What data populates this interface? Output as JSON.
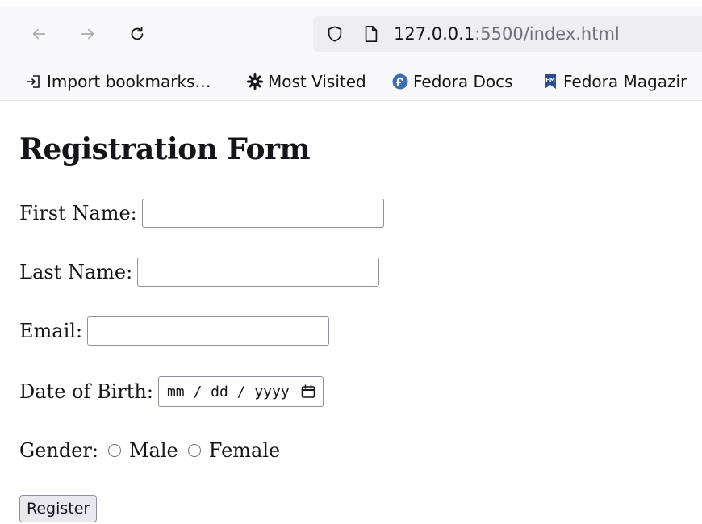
{
  "browser": {
    "url_host": "127.0.0.1",
    "url_rest": ":5500/index.html",
    "bookmarks": [
      {
        "label": "Import bookmarks…",
        "icon": "import-icon"
      },
      {
        "label": "Most Visited",
        "icon": "gear-icon"
      },
      {
        "label": "Fedora Docs",
        "icon": "fedora-icon"
      },
      {
        "label": "Fedora Magazir",
        "icon": "fedora-magazine-icon"
      }
    ]
  },
  "form": {
    "title": "Registration Form",
    "first_name_label": "First Name:",
    "first_name_value": "",
    "last_name_label": "Last Name:",
    "last_name_value": "",
    "email_label": "Email:",
    "email_value": "",
    "dob_label": "Date of Birth:",
    "dob_placeholder": "mm / dd / yyyy",
    "gender_label": "Gender:",
    "gender_options": [
      "Male",
      "Female"
    ],
    "submit_label": "Register"
  },
  "colors": {
    "fedora_blue": "#3c6eb4",
    "magazine_blue": "#2a4d8f"
  }
}
